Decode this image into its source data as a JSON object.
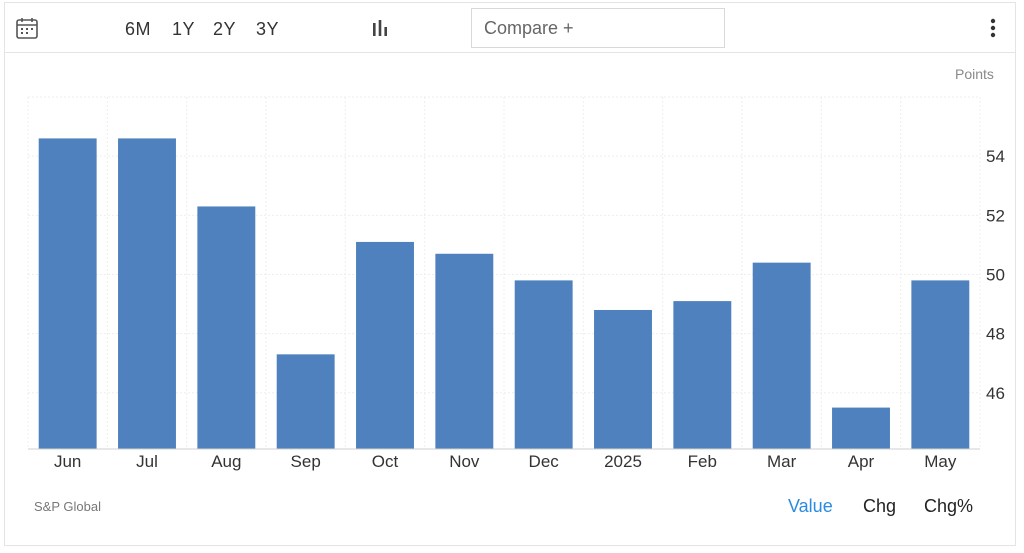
{
  "toolbar": {
    "calendar_icon": "calendar-icon",
    "ranges": [
      "6M",
      "1Y",
      "2Y",
      "3Y"
    ],
    "chart_type_icon": "bar-chart-icon",
    "compare_placeholder": "Compare +",
    "menu_icon": "vertical-ellipsis-icon"
  },
  "colors": {
    "bar": "#4e81bd",
    "grid": "#eeeeee",
    "axis": "#cfcfcf",
    "active_tab": "#2a8ce0"
  },
  "chart_data": {
    "type": "bar",
    "categories": [
      "Jun",
      "Jul",
      "Aug",
      "Sep",
      "Oct",
      "Nov",
      "Dec",
      "2025",
      "Feb",
      "Mar",
      "Apr",
      "May"
    ],
    "values": [
      54.6,
      54.6,
      52.3,
      47.3,
      51.1,
      50.7,
      49.8,
      48.8,
      49.1,
      50.4,
      45.5,
      49.8
    ],
    "ylabel": "Points",
    "yticks": [
      46,
      48,
      50,
      52,
      54
    ],
    "ylim": [
      44.1,
      56
    ],
    "grid": true,
    "axis_side": "right"
  },
  "footer": {
    "source": "S&P Global",
    "tabs": [
      "Value",
      "Chg",
      "Chg%"
    ],
    "active_tab": "Value"
  }
}
